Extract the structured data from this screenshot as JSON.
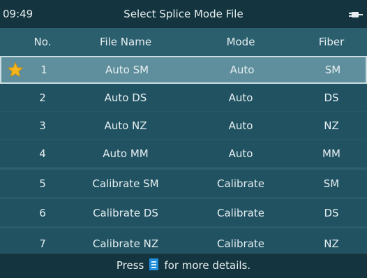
{
  "titlebar": {
    "time": "09:49",
    "title": "Select Splice Mode File",
    "power_icon": "plug-icon"
  },
  "table": {
    "headers": {
      "no": "No.",
      "file_name": "File Name",
      "mode": "Mode",
      "fiber": "Fiber"
    },
    "rows": [
      {
        "no": "1",
        "file_name": "Auto SM",
        "mode": "Auto",
        "fiber": "SM",
        "selected": true,
        "icon": "star-icon"
      },
      {
        "no": "2",
        "file_name": "Auto DS",
        "mode": "Auto",
        "fiber": "DS"
      },
      {
        "no": "3",
        "file_name": "Auto NZ",
        "mode": "Auto",
        "fiber": "NZ"
      },
      {
        "no": "4",
        "file_name": "Auto MM",
        "mode": "Auto",
        "fiber": "MM"
      },
      {
        "no": "5",
        "file_name": "Calibrate SM",
        "mode": "Calibrate",
        "fiber": "SM"
      },
      {
        "no": "6",
        "file_name": "Calibrate DS",
        "mode": "Calibrate",
        "fiber": "DS"
      },
      {
        "no": "7",
        "file_name": "Calibrate NZ",
        "mode": "Calibrate",
        "fiber": "NZ"
      }
    ]
  },
  "footer": {
    "text_before": "Press",
    "icon": "document-icon",
    "text_after": "for more details."
  },
  "colors": {
    "titlebar_bg": "#14353f",
    "table_bg": "#205262",
    "selected_bg": "#5f8f9d",
    "selected_border": "#c9dde2",
    "text": "#e6eef0",
    "star": "#f5b51e",
    "doc_icon": "#1f8fe0"
  }
}
